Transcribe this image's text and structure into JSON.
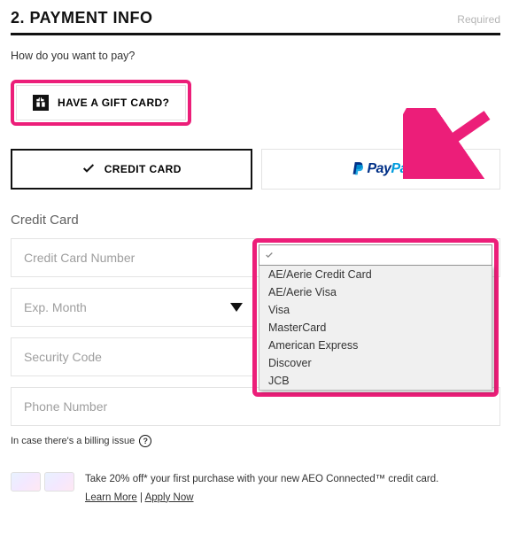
{
  "header": {
    "title": "2. PAYMENT INFO",
    "required_label": "Required"
  },
  "prompt": "How do you want to pay?",
  "giftcard": {
    "label": "HAVE A GIFT CARD?"
  },
  "methods": {
    "credit": "CREDIT CARD",
    "paypal_pay": "Pay",
    "paypal_pal": "Pal"
  },
  "form": {
    "heading": "Credit Card",
    "cc_number_placeholder": "Credit Card Number",
    "exp_month_placeholder": "Exp. Month",
    "security_code_placeholder": "Security Code",
    "phone_placeholder": "Phone Number",
    "billing_note": "In case there's a billing issue",
    "qmark": "?"
  },
  "dropdown": {
    "options": [
      "AE/Aerie Credit Card",
      "AE/Aerie Visa",
      "Visa",
      "MasterCard",
      "American Express",
      "Discover",
      "JCB"
    ]
  },
  "promo": {
    "text": "Take 20% off* your first purchase with your new AEO Connected™ credit card.",
    "learn_more": "Learn More",
    "apply_now": "Apply Now",
    "sep": " | "
  }
}
